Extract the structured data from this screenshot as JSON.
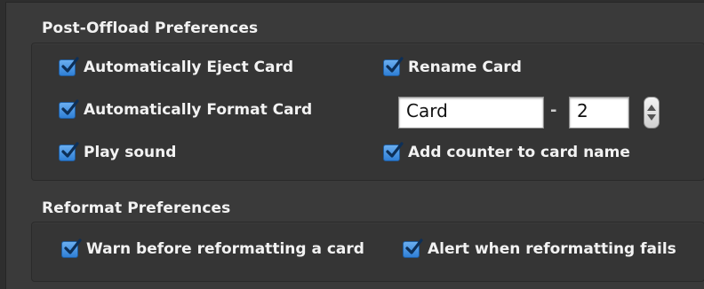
{
  "post_offload": {
    "title": "Post-Offload Preferences",
    "eject_label": "Automatically Eject Card",
    "format_label": "Automatically Format Card",
    "sound_label": "Play sound",
    "rename_label": "Rename Card",
    "card_name_value": "Card",
    "separator": "-",
    "counter_value": "2",
    "add_counter_label": "Add counter to card name"
  },
  "reformat": {
    "title": "Reformat Preferences",
    "warn_label": "Warn before reformatting a card",
    "alert_label": "Alert when reformatting fails"
  },
  "icons": {
    "checkbox": "checkmark-icon",
    "stepper": "stepper-arrows-icon"
  },
  "colors": {
    "background": "#3a3a3a",
    "checkbox_accent": "#2f7fd6",
    "text": "#f2f2f2"
  }
}
